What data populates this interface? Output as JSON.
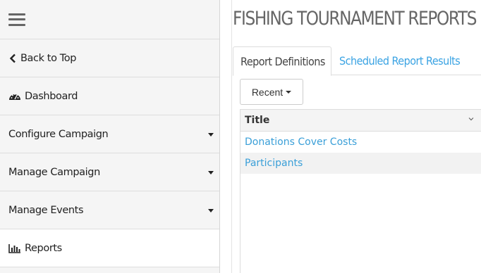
{
  "sidebar": {
    "items": [
      {
        "label": "Back to Top",
        "icon": "chevron-left-icon"
      },
      {
        "label": "Dashboard",
        "icon": "dashboard-icon"
      },
      {
        "label": "Configure Campaign",
        "icon": "caret-down-icon"
      },
      {
        "label": "Manage Campaign",
        "icon": "caret-down-icon"
      },
      {
        "label": "Manage Events",
        "icon": "caret-down-icon"
      },
      {
        "label": "Reports",
        "icon": "bar-chart-icon"
      }
    ]
  },
  "main": {
    "title": "FISHING TOURNAMENT REPORTS",
    "tabs": [
      {
        "label": "Report Definitions"
      },
      {
        "label": "Scheduled Report Results"
      }
    ],
    "filter": {
      "label": "Recent"
    },
    "table": {
      "header": "Title",
      "rows": [
        {
          "title": "Donations Cover Costs"
        },
        {
          "title": "Participants"
        }
      ]
    }
  },
  "colors": {
    "link": "#3aa3e3",
    "title": "#666666",
    "sidebar_bg": "#f5f5f5"
  }
}
